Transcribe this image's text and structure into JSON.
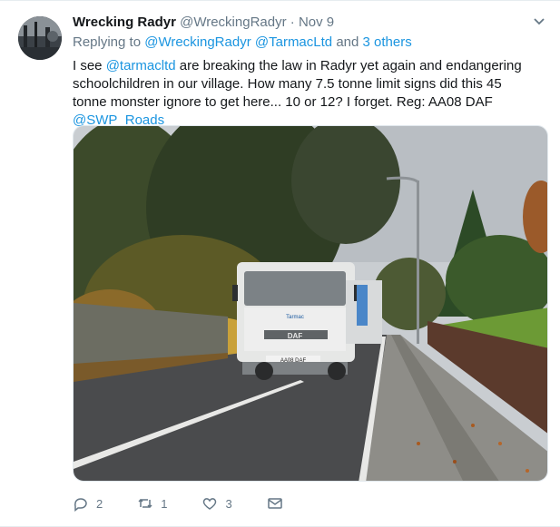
{
  "tweet": {
    "author_name": "Wrecking Radyr",
    "author_handle": "@WreckingRadyr",
    "separator": "·",
    "date": "Nov 9",
    "reply_prefix": "Replying to",
    "reply_to_1": "@WreckingRadyr",
    "reply_to_2": "@TarmacLtd",
    "reply_and": "and",
    "reply_others": "3 others",
    "text_part1": "I see ",
    "text_mention": "@tarmacltd",
    "text_part2": " are breaking the law in Radyr yet again and endangering schoolchildren in our village. How many 7.5 tonne limit signs did this 45 tonne monster ignore to get here... 10 or 12? I forget. Reg: AA08 DAF ",
    "text_mention2": "@SWP_Roads",
    "truck_brand": "DAF",
    "truck_plate": "AA08 DAF",
    "truck_logo": "Tarmac"
  },
  "actions": {
    "reply_count": "2",
    "retweet_count": "1",
    "like_count": "3"
  },
  "icons": {
    "caret": "chevron-down-icon",
    "reply": "reply-icon",
    "retweet": "retweet-icon",
    "like": "heart-icon",
    "dm": "envelope-icon"
  },
  "colors": {
    "link": "#1b95e0",
    "muted": "#657786"
  }
}
